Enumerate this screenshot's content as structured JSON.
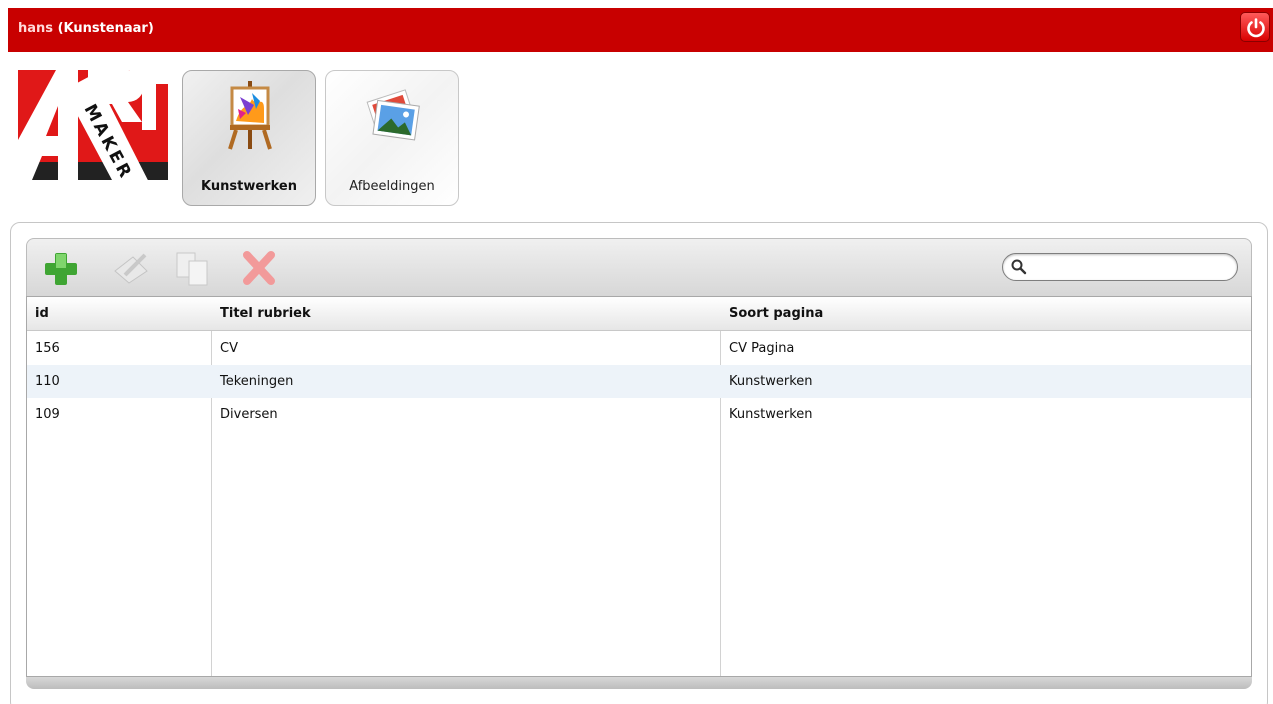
{
  "header": {
    "username": "hans",
    "role": "(Kunstenaar)",
    "power_icon": "power-icon",
    "bar_color": "#c80000"
  },
  "logo": {
    "text": "ART MAKER"
  },
  "modules": [
    {
      "label": "Kunstwerken",
      "icon": "easel-painting-icon",
      "active": true
    },
    {
      "label": "Afbeeldingen",
      "icon": "photos-icon",
      "active": false
    }
  ],
  "toolbar": {
    "add_icon": "add-plus-icon",
    "edit_icon": "edit-pencil-icon",
    "copy_icon": "copy-pages-icon",
    "delete_icon": "delete-x-icon",
    "search": {
      "value": "",
      "placeholder": ""
    }
  },
  "table": {
    "columns": [
      "id",
      "Titel rubriek",
      "Soort pagina"
    ],
    "rows": [
      {
        "id": "156",
        "title": "CV",
        "type": "CV Pagina"
      },
      {
        "id": "110",
        "title": "Tekeningen",
        "type": "Kunstwerken"
      },
      {
        "id": "109",
        "title": "Diversen",
        "type": "Kunstwerken"
      }
    ]
  }
}
